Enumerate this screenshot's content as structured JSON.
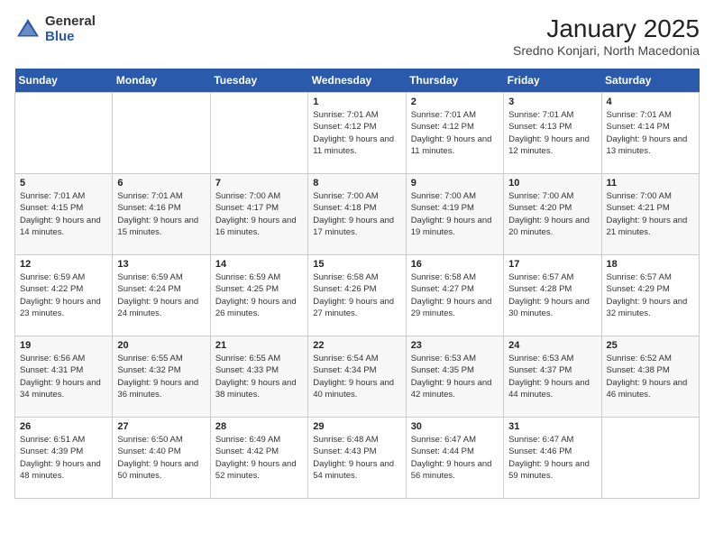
{
  "header": {
    "logo_general": "General",
    "logo_blue": "Blue",
    "month_title": "January 2025",
    "location": "Sredno Konjari, North Macedonia"
  },
  "days_of_week": [
    "Sunday",
    "Monday",
    "Tuesday",
    "Wednesday",
    "Thursday",
    "Friday",
    "Saturday"
  ],
  "weeks": [
    [
      {
        "day": "",
        "sunrise": "",
        "sunset": "",
        "daylight": ""
      },
      {
        "day": "",
        "sunrise": "",
        "sunset": "",
        "daylight": ""
      },
      {
        "day": "",
        "sunrise": "",
        "sunset": "",
        "daylight": ""
      },
      {
        "day": "1",
        "sunrise": "7:01 AM",
        "sunset": "4:12 PM",
        "daylight": "9 hours and 11 minutes."
      },
      {
        "day": "2",
        "sunrise": "7:01 AM",
        "sunset": "4:12 PM",
        "daylight": "9 hours and 11 minutes."
      },
      {
        "day": "3",
        "sunrise": "7:01 AM",
        "sunset": "4:13 PM",
        "daylight": "9 hours and 12 minutes."
      },
      {
        "day": "4",
        "sunrise": "7:01 AM",
        "sunset": "4:14 PM",
        "daylight": "9 hours and 13 minutes."
      }
    ],
    [
      {
        "day": "5",
        "sunrise": "7:01 AM",
        "sunset": "4:15 PM",
        "daylight": "9 hours and 14 minutes."
      },
      {
        "day": "6",
        "sunrise": "7:01 AM",
        "sunset": "4:16 PM",
        "daylight": "9 hours and 15 minutes."
      },
      {
        "day": "7",
        "sunrise": "7:00 AM",
        "sunset": "4:17 PM",
        "daylight": "9 hours and 16 minutes."
      },
      {
        "day": "8",
        "sunrise": "7:00 AM",
        "sunset": "4:18 PM",
        "daylight": "9 hours and 17 minutes."
      },
      {
        "day": "9",
        "sunrise": "7:00 AM",
        "sunset": "4:19 PM",
        "daylight": "9 hours and 19 minutes."
      },
      {
        "day": "10",
        "sunrise": "7:00 AM",
        "sunset": "4:20 PM",
        "daylight": "9 hours and 20 minutes."
      },
      {
        "day": "11",
        "sunrise": "7:00 AM",
        "sunset": "4:21 PM",
        "daylight": "9 hours and 21 minutes."
      }
    ],
    [
      {
        "day": "12",
        "sunrise": "6:59 AM",
        "sunset": "4:22 PM",
        "daylight": "9 hours and 23 minutes."
      },
      {
        "day": "13",
        "sunrise": "6:59 AM",
        "sunset": "4:24 PM",
        "daylight": "9 hours and 24 minutes."
      },
      {
        "day": "14",
        "sunrise": "6:59 AM",
        "sunset": "4:25 PM",
        "daylight": "9 hours and 26 minutes."
      },
      {
        "day": "15",
        "sunrise": "6:58 AM",
        "sunset": "4:26 PM",
        "daylight": "9 hours and 27 minutes."
      },
      {
        "day": "16",
        "sunrise": "6:58 AM",
        "sunset": "4:27 PM",
        "daylight": "9 hours and 29 minutes."
      },
      {
        "day": "17",
        "sunrise": "6:57 AM",
        "sunset": "4:28 PM",
        "daylight": "9 hours and 30 minutes."
      },
      {
        "day": "18",
        "sunrise": "6:57 AM",
        "sunset": "4:29 PM",
        "daylight": "9 hours and 32 minutes."
      }
    ],
    [
      {
        "day": "19",
        "sunrise": "6:56 AM",
        "sunset": "4:31 PM",
        "daylight": "9 hours and 34 minutes."
      },
      {
        "day": "20",
        "sunrise": "6:55 AM",
        "sunset": "4:32 PM",
        "daylight": "9 hours and 36 minutes."
      },
      {
        "day": "21",
        "sunrise": "6:55 AM",
        "sunset": "4:33 PM",
        "daylight": "9 hours and 38 minutes."
      },
      {
        "day": "22",
        "sunrise": "6:54 AM",
        "sunset": "4:34 PM",
        "daylight": "9 hours and 40 minutes."
      },
      {
        "day": "23",
        "sunrise": "6:53 AM",
        "sunset": "4:35 PM",
        "daylight": "9 hours and 42 minutes."
      },
      {
        "day": "24",
        "sunrise": "6:53 AM",
        "sunset": "4:37 PM",
        "daylight": "9 hours and 44 minutes."
      },
      {
        "day": "25",
        "sunrise": "6:52 AM",
        "sunset": "4:38 PM",
        "daylight": "9 hours and 46 minutes."
      }
    ],
    [
      {
        "day": "26",
        "sunrise": "6:51 AM",
        "sunset": "4:39 PM",
        "daylight": "9 hours and 48 minutes."
      },
      {
        "day": "27",
        "sunrise": "6:50 AM",
        "sunset": "4:40 PM",
        "daylight": "9 hours and 50 minutes."
      },
      {
        "day": "28",
        "sunrise": "6:49 AM",
        "sunset": "4:42 PM",
        "daylight": "9 hours and 52 minutes."
      },
      {
        "day": "29",
        "sunrise": "6:48 AM",
        "sunset": "4:43 PM",
        "daylight": "9 hours and 54 minutes."
      },
      {
        "day": "30",
        "sunrise": "6:47 AM",
        "sunset": "4:44 PM",
        "daylight": "9 hours and 56 minutes."
      },
      {
        "day": "31",
        "sunrise": "6:47 AM",
        "sunset": "4:46 PM",
        "daylight": "9 hours and 59 minutes."
      },
      {
        "day": "",
        "sunrise": "",
        "sunset": "",
        "daylight": ""
      }
    ]
  ]
}
